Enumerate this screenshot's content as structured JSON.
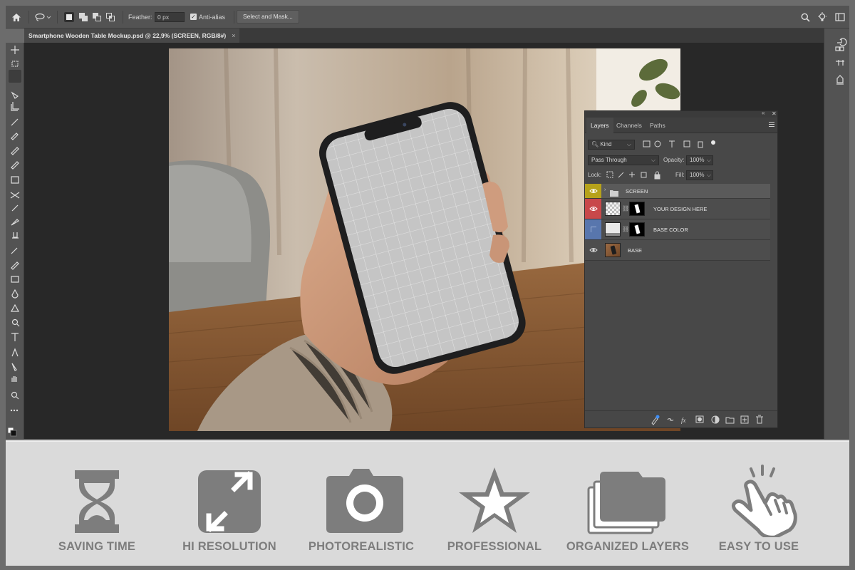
{
  "options_bar": {
    "feather_label": "Feather:",
    "feather_value": "0 px",
    "antialias_label": "Anti-alias",
    "select_mask_label": "Select and Mask..."
  },
  "document_tab": {
    "title": "Smartphone Wooden Table Mockup.psd @ 22,9% (SCREEN, RGB/8#)",
    "close": "×"
  },
  "layers_panel": {
    "tabs": [
      "Layers",
      "Channels",
      "Paths"
    ],
    "kind_label": "Kind",
    "blend_mode": "Pass Through",
    "opacity_label": "Opacity:",
    "opacity_value": "100%",
    "lock_label": "Lock:",
    "fill_label": "Fill:",
    "fill_value": "100%",
    "layers": [
      {
        "name": "SCREEN",
        "color": "#b6a21a",
        "type": "group"
      },
      {
        "name": "YOUR DESIGN HERE",
        "color": "#c8484a",
        "type": "smart-object-masked"
      },
      {
        "name": "BASE COLOR",
        "color": "#5876ad",
        "type": "fill-masked"
      },
      {
        "name": "BASE",
        "color": "",
        "type": "image"
      }
    ]
  },
  "features": [
    {
      "label": "SAVING TIME",
      "icon": "hourglass-icon"
    },
    {
      "label": "HI RESOLUTION",
      "icon": "expand-arrows-icon"
    },
    {
      "label": "PHOTOREALISTIC",
      "icon": "camera-icon"
    },
    {
      "label": "PROFESSIONAL",
      "icon": "star-icon"
    },
    {
      "label": "ORGANIZED LAYERS",
      "icon": "folders-icon"
    },
    {
      "label": "EASY TO USE",
      "icon": "tap-hand-icon"
    }
  ],
  "colors": {
    "ui_dark": "#535353",
    "canvas_bg": "#282828",
    "feature_bg": "#dadada",
    "feature_icon": "#7d7d7d"
  }
}
